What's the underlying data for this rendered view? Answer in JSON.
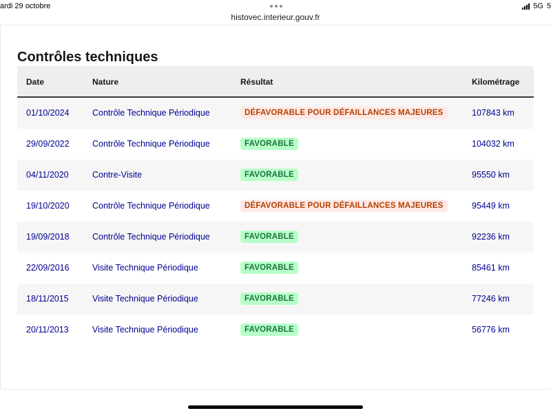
{
  "status_bar": {
    "date": "ardi 29 octobre",
    "network": "5G",
    "battery_partial": "5"
  },
  "browser": {
    "url": "histovec.interieur.gouv.fr"
  },
  "section": {
    "title": "Contrôles techniques"
  },
  "table": {
    "headers": {
      "date": "Date",
      "nature": "Nature",
      "result": "Résultat",
      "km": "Kilométrage"
    },
    "rows": [
      {
        "date": "01/10/2024",
        "nature": "Contrôle Technique Périodique",
        "result": "DÉFAVORABLE POUR DÉFAILLANCES MAJEURES",
        "status": "ko",
        "km": "107843 km"
      },
      {
        "date": "29/09/2022",
        "nature": "Contrôle Technique Périodique",
        "result": "FAVORABLE",
        "status": "ok",
        "km": "104032 km"
      },
      {
        "date": "04/11/2020",
        "nature": "Contre-Visite",
        "result": "FAVORABLE",
        "status": "ok",
        "km": "95550 km"
      },
      {
        "date": "19/10/2020",
        "nature": "Contrôle Technique Périodique",
        "result": "DÉFAVORABLE POUR DÉFAILLANCES MAJEURES",
        "status": "ko",
        "km": "95449 km"
      },
      {
        "date": "19/09/2018",
        "nature": "Contrôle Technique Périodique",
        "result": "FAVORABLE",
        "status": "ok",
        "km": "92236 km"
      },
      {
        "date": "22/09/2016",
        "nature": "Visite Technique Périodique",
        "result": "FAVORABLE",
        "status": "ok",
        "km": "85461 km"
      },
      {
        "date": "18/11/2015",
        "nature": "Visite Technique Périodique",
        "result": "FAVORABLE",
        "status": "ok",
        "km": "77246 km"
      },
      {
        "date": "20/11/2013",
        "nature": "Visite Technique Périodique",
        "result": "FAVORABLE",
        "status": "ok",
        "km": "56776 km"
      }
    ]
  },
  "colors": {
    "link_blue": "#000091",
    "ok_bg": "#b8fec9",
    "ok_text": "#18753c",
    "ko_bg": "#ffe9e6",
    "ko_text": "#b34000"
  }
}
